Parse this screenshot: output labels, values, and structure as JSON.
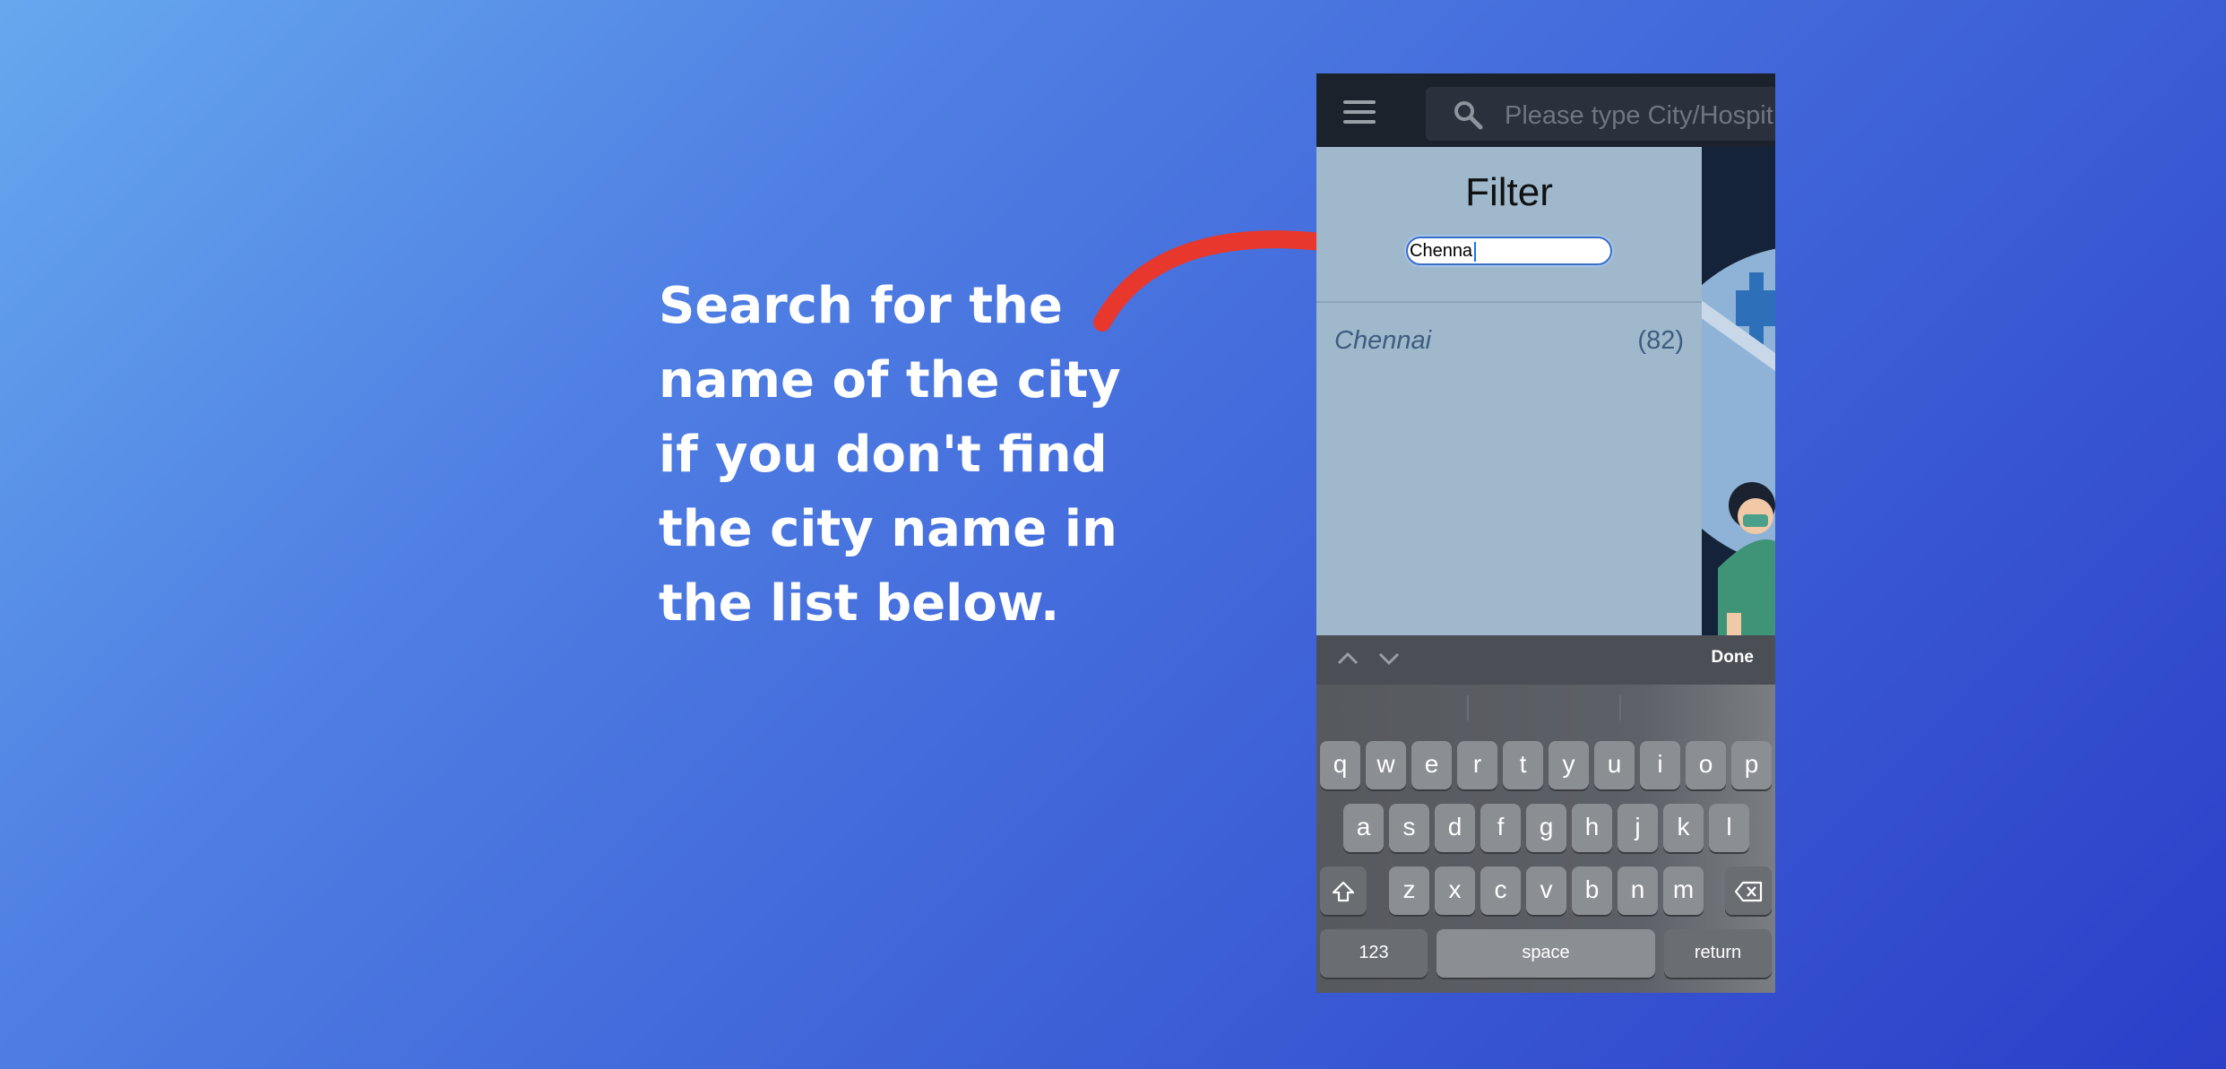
{
  "instruction": {
    "lines": [
      "Search for the",
      "name of the city",
      "if you don't find",
      "the city name in",
      "the list below."
    ]
  },
  "app": {
    "search_placeholder": "Please type City/Hospit",
    "filter": {
      "title": "Filter",
      "input_value": "Chenna",
      "results": [
        {
          "city": "Chennai",
          "count": "(82)"
        }
      ]
    }
  },
  "keyboard": {
    "done_label": "Done",
    "row1": [
      "q",
      "w",
      "e",
      "r",
      "t",
      "y",
      "u",
      "i",
      "o",
      "p"
    ],
    "row2": [
      "a",
      "s",
      "d",
      "f",
      "g",
      "h",
      "j",
      "k",
      "l"
    ],
    "row3": [
      "z",
      "x",
      "c",
      "v",
      "b",
      "n",
      "m"
    ],
    "numbers_label": "123",
    "space_label": "space",
    "return_label": "return"
  },
  "colors": {
    "arrow": "#e8372d",
    "panel": "#9fb8cc",
    "accent": "#3a6ec4"
  },
  "icons": [
    "menu-icon",
    "search-icon",
    "arrow-up-icon",
    "arrow-down-icon",
    "shift-icon",
    "backspace-icon",
    "emoji-icon",
    "microphone-icon"
  ]
}
